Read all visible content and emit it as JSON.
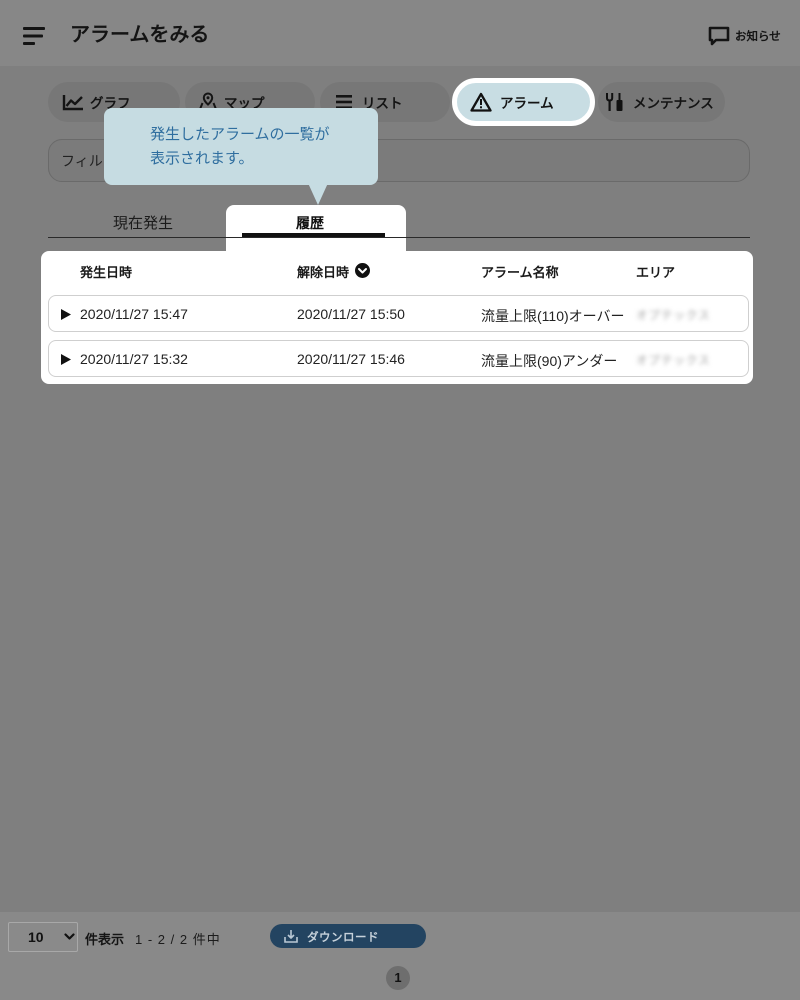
{
  "header": {
    "title": "アラームをみる",
    "menu_icon": "hamburger-menu-icon",
    "notice_icon": "chat-bubble-icon",
    "notice_label": "お知らせ"
  },
  "nav_tabs": [
    {
      "label": "グラフ",
      "icon": "line-chart-icon",
      "active": false
    },
    {
      "label": "マップ",
      "icon": "map-pin-icon",
      "active": false
    },
    {
      "label": "リスト",
      "icon": "list-icon",
      "active": false
    },
    {
      "label": "アラーム",
      "icon": "warning-icon",
      "active": true
    },
    {
      "label": "メンテナンス",
      "icon": "tools-icon",
      "active": false
    }
  ],
  "filter": {
    "placeholder": "フィル"
  },
  "tooltip": {
    "lines": [
      "発生したアラームの一覧が",
      "表示されます。"
    ]
  },
  "sub_tabs": [
    {
      "label": "現在発生",
      "active": false
    },
    {
      "label": "履歴",
      "active": true
    }
  ],
  "table": {
    "columns": [
      "発生日時",
      "解除日時",
      "アラーム名称",
      "エリア"
    ],
    "sorted_column": "解除日時",
    "sort_icon": "chevron-down-circle-icon",
    "row_expand_icon": "play-triangle-icon",
    "rows": [
      {
        "occurred_at": "2020/11/27 15:47",
        "cleared_at": "2020/11/27 15:50",
        "alarm_name": "流量上限(110)オーバー",
        "area": "オプテックス"
      },
      {
        "occurred_at": "2020/11/27 15:32",
        "cleared_at": "2020/11/27 15:46",
        "alarm_name": "流量上限(90)アンダー",
        "area": "オプテックス"
      }
    ]
  },
  "footer": {
    "page_size": "10",
    "page_size_icon": "chevron-down-icon",
    "page_size_suffix": "件表示",
    "range": "1 - 2 / 2 件中",
    "download_icon": "download-tray-icon",
    "download_label": "ダウンロード",
    "current_page": "1"
  },
  "colors": {
    "overlay_bg": "#7f7f7f",
    "tooltip_bg": "#c6dce2",
    "tooltip_text": "#2f6e9f",
    "active_tab_bg": "#c8dde3",
    "download_button_bg": "#234461"
  }
}
